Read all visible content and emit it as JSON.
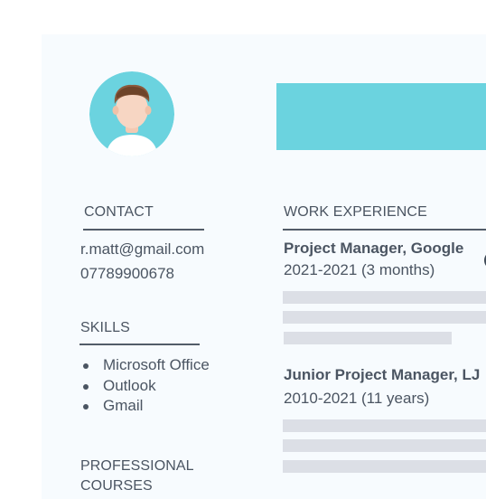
{
  "left_column": {
    "contact": {
      "heading": "CONTACT",
      "email": "r.matt@gmail.com",
      "phone": "07789900678"
    },
    "skills": {
      "heading": "SKILLS",
      "items": [
        "Microsoft Office",
        "Outlook",
        "Gmail"
      ]
    },
    "courses": {
      "heading_line1": "PROFESSIONAL",
      "heading_line2": "COURSES"
    }
  },
  "work_experience": {
    "heading": "WORK EXPERIENCE",
    "jobs": [
      {
        "title": "Project Manager, Google",
        "period": "2021-2021 (3 months)"
      },
      {
        "title": "Junior Project Manager, LJ",
        "period": "2010-2021 (11 years)"
      }
    ]
  },
  "colors": {
    "accent": "#6bd3df",
    "sheet": "#f7fbfe",
    "placeholder_bar": "#dcdfe6",
    "text": "#4b5562"
  },
  "icons": {
    "avatar": "person-avatar-icon"
  }
}
